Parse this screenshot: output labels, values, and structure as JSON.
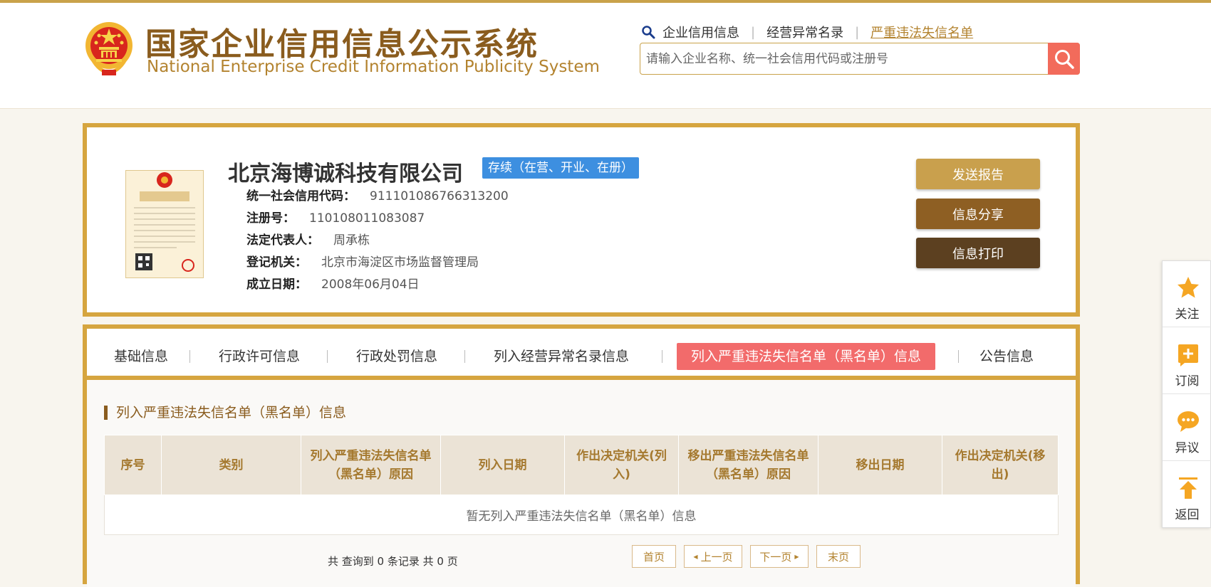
{
  "colors": {
    "gold": "#d6a53f",
    "brown": "#8a5c1e",
    "tab_active": "#f26b6b",
    "status_blue": "#3d8fe0",
    "search_btn": "#f26b5b",
    "icon_orange": "#f5a623"
  },
  "header": {
    "title_cn": "国家企业信用信息公示系统",
    "title_en": "National Enterprise Credit Information Publicity System",
    "emblem_icon": "national-emblem-icon",
    "nav": [
      {
        "label": "企业信用信息"
      },
      {
        "label": "经营异常名录"
      },
      {
        "label": "严重违法失信名单"
      }
    ],
    "search": {
      "placeholder": "请输入企业名称、统一社会信用代码或注册号",
      "icon": "search-icon"
    }
  },
  "company": {
    "name": "北京海博诚科技有限公司",
    "status": "存续（在营、开业、在册）",
    "license_icon": "business-license-icon",
    "fields": [
      {
        "label": "统一社会信用代码：",
        "value": "911101086766313200"
      },
      {
        "label": "注册号：",
        "value": "110108011083087"
      },
      {
        "label": "法定代表人：",
        "value": "周承栋"
      },
      {
        "label": "登记机关：",
        "value": "北京市海淀区市场监督管理局"
      },
      {
        "label": "成立日期：",
        "value": "2008年06月04日"
      }
    ],
    "actions": [
      {
        "label": "发送报告"
      },
      {
        "label": "信息分享"
      },
      {
        "label": "信息打印"
      }
    ]
  },
  "tabs": [
    {
      "label": "基础信息"
    },
    {
      "label": "行政许可信息"
    },
    {
      "label": "行政处罚信息"
    },
    {
      "label": "列入经营异常名录信息"
    },
    {
      "label": "列入严重违法失信名单（黑名单）信息",
      "active": true
    },
    {
      "label": "公告信息"
    }
  ],
  "section": {
    "title": "列入严重违法失信名单（黑名单）信息",
    "columns": [
      "序号",
      "类别",
      "列入严重违法失信名单（黑名单）原因",
      "列入日期",
      "作出决定机关(列入)",
      "移出严重违法失信名单（黑名单）原因",
      "移出日期",
      "作出决定机关(移出)"
    ],
    "empty_text": "暂无列入严重违法失信名单（黑名单）信息"
  },
  "pager": {
    "info": "共 查询到 0 条记录 共 0 页",
    "first": "首页",
    "prev": "上一页",
    "next": "下一页",
    "last": "末页"
  },
  "side": [
    {
      "label": "关注",
      "icon": "star-icon"
    },
    {
      "label": "订阅",
      "icon": "subscribe-icon"
    },
    {
      "label": "异议",
      "icon": "chat-bubble-icon"
    },
    {
      "label": "返回",
      "icon": "back-to-top-icon"
    }
  ]
}
